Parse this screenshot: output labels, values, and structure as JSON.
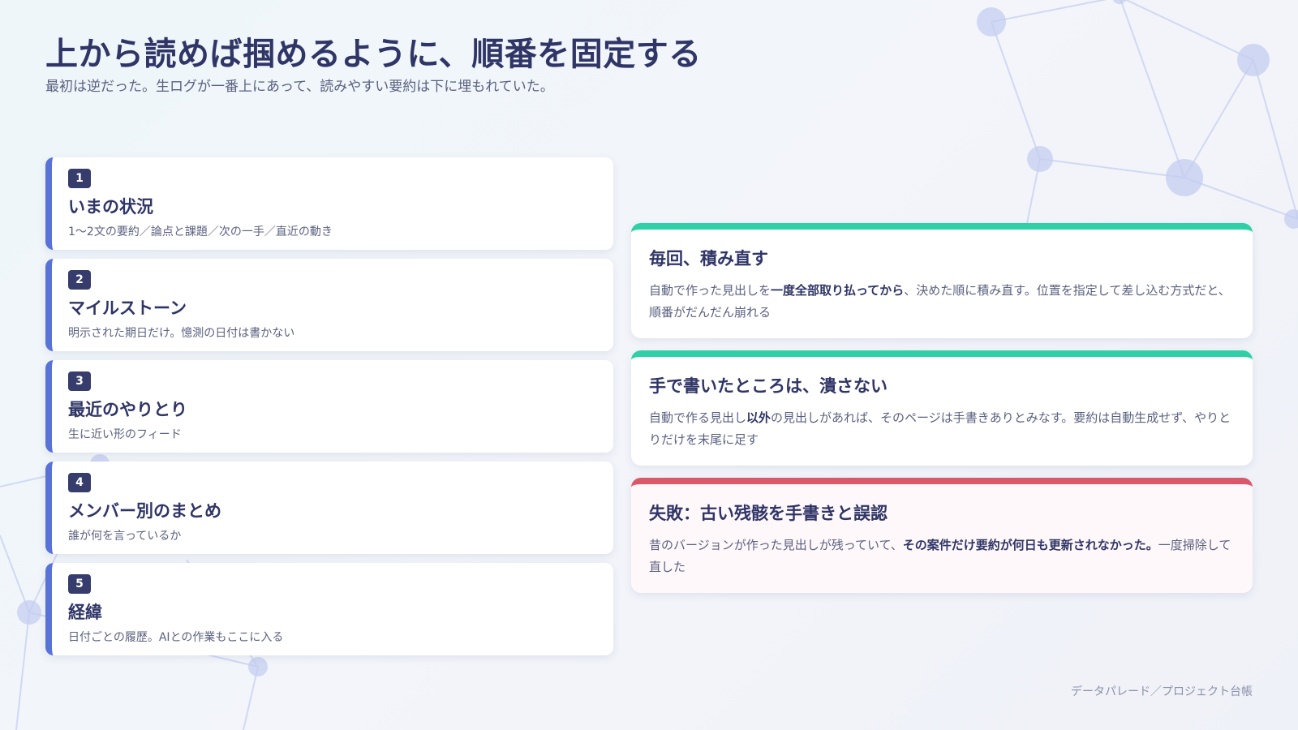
{
  "header": {
    "title": "上から読めば掴めるように、順番を固定する",
    "subtitle": "最初は逆だった。生ログが一番上にあって、読みやすい要約は下に埋もれていた。"
  },
  "steps": [
    {
      "num": "1",
      "title": "いまの状況",
      "desc": "1〜2文の要約／論点と課題／次の一手／直近の動き"
    },
    {
      "num": "2",
      "title": "マイルストーン",
      "desc": "明示された期日だけ。憶測の日付は書かない"
    },
    {
      "num": "3",
      "title": "最近のやりとり",
      "desc": "生に近い形のフィード"
    },
    {
      "num": "4",
      "title": "メンバー別のまとめ",
      "desc": "誰が何を言っているか"
    },
    {
      "num": "5",
      "title": "経緯",
      "desc": "日付ごとの履歴。AIとの作業もここに入る"
    }
  ],
  "rules": [
    {
      "title": "毎回、積み直す",
      "body_before": "自動で作った見出しを",
      "body_bold": "一度全部取り払ってから",
      "body_after": "、決めた順に積み直す。位置を指定して差し込む方式だと、順番がだんだん崩れる"
    },
    {
      "title": "手で書いたところは、潰さない",
      "body_before": "自動で作る見出し",
      "body_bold": "以外",
      "body_after": "の見出しがあれば、そのページは手書きありとみなす。要約は自動生成せず、やりとりだけを末尾に足す"
    },
    {
      "title": "失敗：古い残骸を手書きと誤認",
      "body_before": "昔のバージョンが作った見出しが残っていて、",
      "body_bold": "その案件だけ要約が何日も更新されなかった。",
      "body_after": "一度掃除して直した"
    }
  ],
  "footer": {
    "text": "データパレード／プロジェクト台帳"
  },
  "colors": {
    "accent_blue": "#5872d8",
    "accent_green": "#2fd0a5",
    "accent_red": "#d9586a",
    "text_dark": "#2f3566"
  }
}
